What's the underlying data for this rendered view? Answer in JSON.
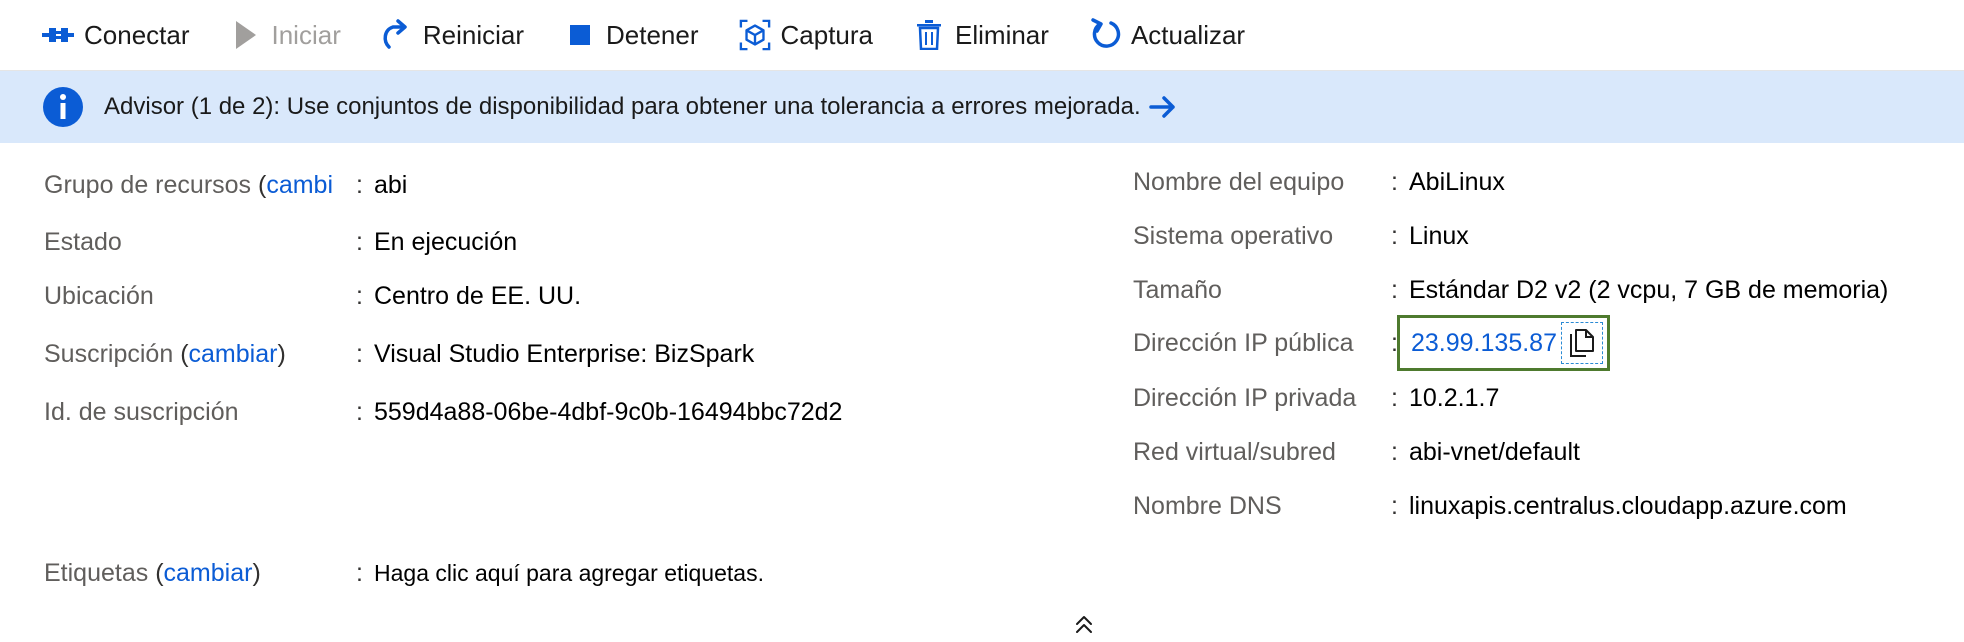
{
  "toolbar": {
    "connect": "Conectar",
    "start": "Iniciar",
    "restart": "Reiniciar",
    "stop": "Detener",
    "capture": "Captura",
    "delete": "Eliminar",
    "refresh": "Actualizar"
  },
  "banner": {
    "message": "Advisor (1 de 2): Use conjuntos de disponibilidad para obtener una tolerancia a errores mejorada."
  },
  "left": {
    "resource_group": {
      "label": "Grupo de recursos",
      "change": "cambi",
      "value": "abi"
    },
    "status": {
      "label": "Estado",
      "value": "En ejecución"
    },
    "location": {
      "label": "Ubicación",
      "value": "Centro de EE. UU."
    },
    "subscription": {
      "label": "Suscripción",
      "change": "cambiar",
      "value": "Visual Studio Enterprise: BizSpark"
    },
    "subscription_id": {
      "label": "Id. de suscripción",
      "value": "559d4a88-06be-4dbf-9c0b-16494bbc72d2"
    },
    "tags": {
      "label": "Etiquetas",
      "change": "cambiar",
      "value": "Haga clic aquí para agregar etiquetas."
    }
  },
  "right": {
    "computer_name": {
      "label": "Nombre del equipo",
      "value": "AbiLinux"
    },
    "os": {
      "label": "Sistema operativo",
      "value": "Linux"
    },
    "size": {
      "label": "Tamaño",
      "value": "Estándar D2 v2 (2 vcpu, 7 GB de memoria)"
    },
    "public_ip": {
      "label": "Dirección IP pública",
      "value": "23.99.135.87"
    },
    "private_ip": {
      "label": "Dirección IP privada",
      "value": "10.2.1.7"
    },
    "vnet": {
      "label": "Red virtual/subred",
      "value": "abi-vnet/default"
    },
    "dns": {
      "label": "Nombre DNS",
      "value": "linuxapis.centralus.cloudapp.azure.com"
    }
  },
  "common": {
    "separator": ":",
    "open_paren": "(",
    "close_paren": ")"
  },
  "colors": {
    "accent": "#0b5cd5",
    "banner_bg": "#d9e8fb",
    "highlight_border": "#4e7a2e"
  },
  "icons": [
    "connect-icon",
    "play-icon",
    "restart-icon",
    "stop-icon",
    "capture-icon",
    "trash-icon",
    "refresh-icon",
    "info-icon",
    "arrow-right-icon",
    "copy-icon",
    "chevron-double-up-icon"
  ]
}
